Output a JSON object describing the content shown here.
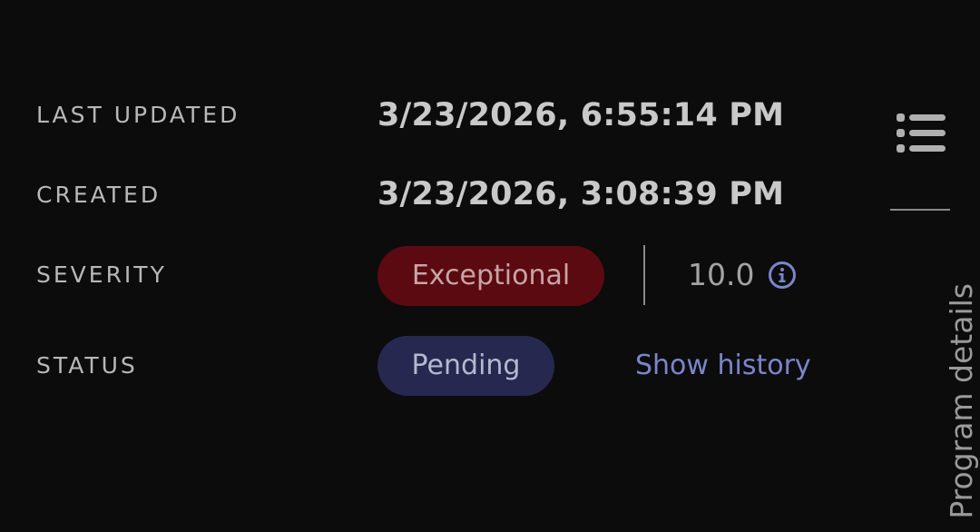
{
  "details": {
    "last_updated": {
      "label": "LAST UPDATED",
      "value": "3/23/2026, 6:55:14 PM"
    },
    "created": {
      "label": "CREATED",
      "value": "3/23/2026, 3:08:39 PM"
    },
    "severity": {
      "label": "SEVERITY",
      "badge": "Exceptional",
      "score": "10.0",
      "info_icon": "info-circle-icon",
      "badge_color": "#5a0a10"
    },
    "status": {
      "label": "STATUS",
      "badge": "Pending",
      "history_link": "Show history",
      "badge_color": "#26284f"
    }
  },
  "side_panel": {
    "icon": "list-icon",
    "tab_label": "Program details"
  },
  "colors": {
    "background": "#0c0c0d",
    "link": "#7b85c9"
  }
}
